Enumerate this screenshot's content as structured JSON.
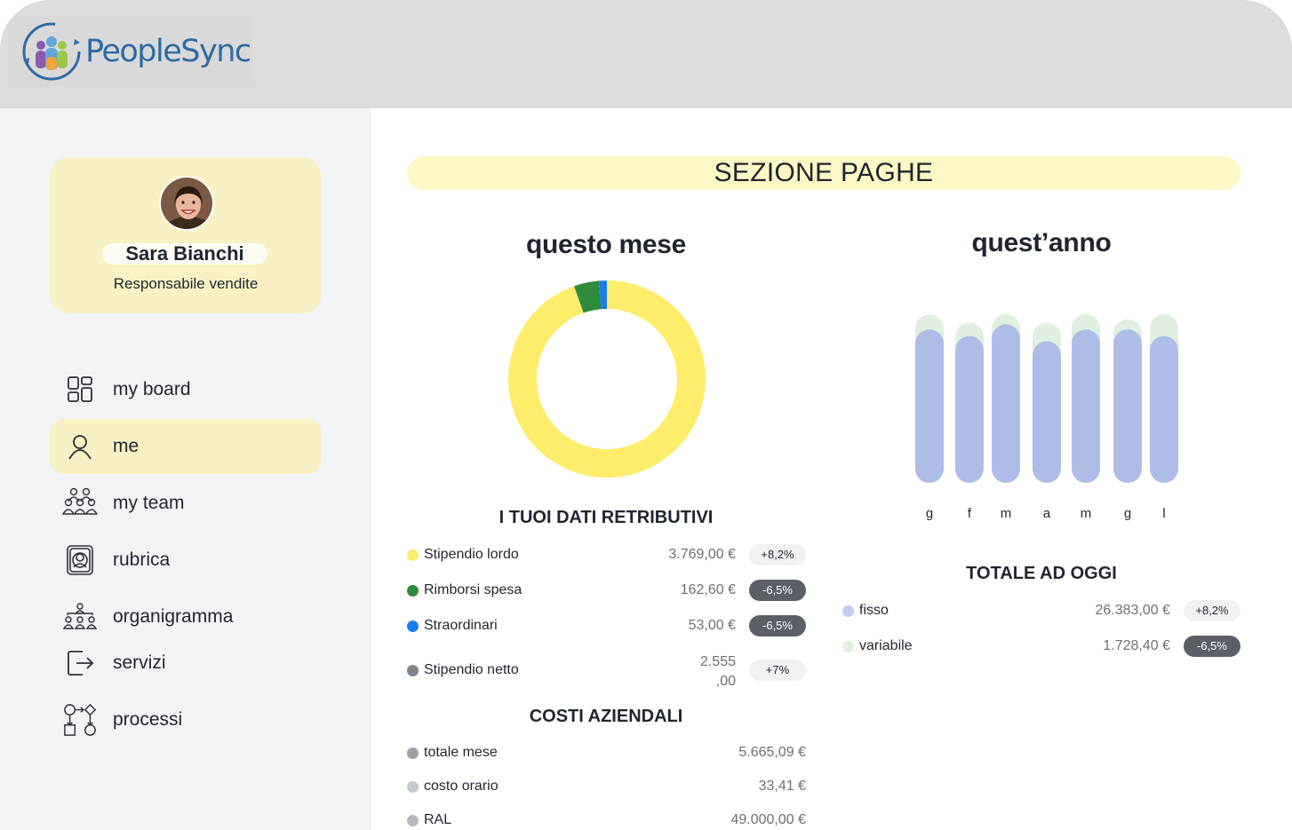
{
  "app": {
    "name": "PeopleSync"
  },
  "profile": {
    "name": "Sara Bianchi",
    "role": "Responsabile vendite"
  },
  "nav": {
    "items": [
      {
        "label": "my board",
        "icon": "dashboard-icon"
      },
      {
        "label": "me",
        "icon": "user-icon",
        "active": true
      },
      {
        "label": "my team",
        "icon": "team-icon"
      },
      {
        "label": "rubrica",
        "icon": "contacts-icon"
      },
      {
        "label": "organigramma",
        "icon": "org-chart-icon"
      },
      {
        "label": "servizi",
        "icon": "logout-icon"
      },
      {
        "label": "processi",
        "icon": "process-icon"
      }
    ]
  },
  "section": {
    "title": "SEZIONE PAGHE"
  },
  "month": {
    "title": "questo mese",
    "data_title": "I TUOI DATI RETRIBUTIVI",
    "rows": [
      {
        "label": "Stipendio lordo",
        "value": "3.769,00 €",
        "badge": "+8,2%",
        "color": "#fded6b"
      },
      {
        "label": "Rimborsi spesa",
        "value": "162,60 €",
        "badge": "-6,5%",
        "color": "#2e8b3a"
      },
      {
        "label": "Straordinari",
        "value": "53,00 €",
        "badge": "-6,5%",
        "color": "#1a7cf0"
      },
      {
        "label": "Stipendio netto",
        "value_line1": "2.555",
        "value_line2": ",00",
        "badge": "+7%",
        "color": "#7e848c"
      }
    ],
    "costs_title": "COSTI AZIENDALI",
    "costs": [
      {
        "label": "totale mese",
        "value": "5.665,09 €",
        "color": "#9ca1a8"
      },
      {
        "label": "costo orario",
        "value": "33,41 €",
        "color": "#c5c8cc"
      },
      {
        "label": "RAL",
        "value": "49.000,00 €",
        "color": "#b5b9be"
      }
    ]
  },
  "year": {
    "title": "quest’anno",
    "totals_title": "TOTALE AD OGGI",
    "totals": [
      {
        "label": "fisso",
        "value": "26.383,00 €",
        "badge": "+8,2%",
        "color": "#c3cdf0"
      },
      {
        "label": "variabile",
        "value": "1.728,40 €",
        "badge": "-6,5%",
        "color": "#e0efe0"
      }
    ]
  },
  "chart_data": [
    {
      "type": "pie",
      "variant": "donut",
      "title": "questo mese",
      "categories": [
        "Stipendio lordo",
        "Rimborsi spesa",
        "Straordinari"
      ],
      "values": [
        3769.0,
        162.6,
        53.0
      ],
      "colors": [
        "#fded6b",
        "#2e8b3a",
        "#1a7cf0"
      ]
    },
    {
      "type": "bar",
      "title": "quest’anno",
      "categories": [
        "g",
        "f",
        "m",
        "a",
        "m",
        "g",
        "l"
      ],
      "series": [
        {
          "name": "fisso",
          "values": [
            0.91,
            0.87,
            0.94,
            0.84,
            0.91,
            0.91,
            0.87
          ],
          "color": "#adbde8"
        },
        {
          "name": "variabile",
          "values": [
            0.09,
            0.08,
            0.06,
            0.11,
            0.09,
            0.06,
            0.13
          ],
          "color": "#e0efe0"
        }
      ]
    }
  ]
}
